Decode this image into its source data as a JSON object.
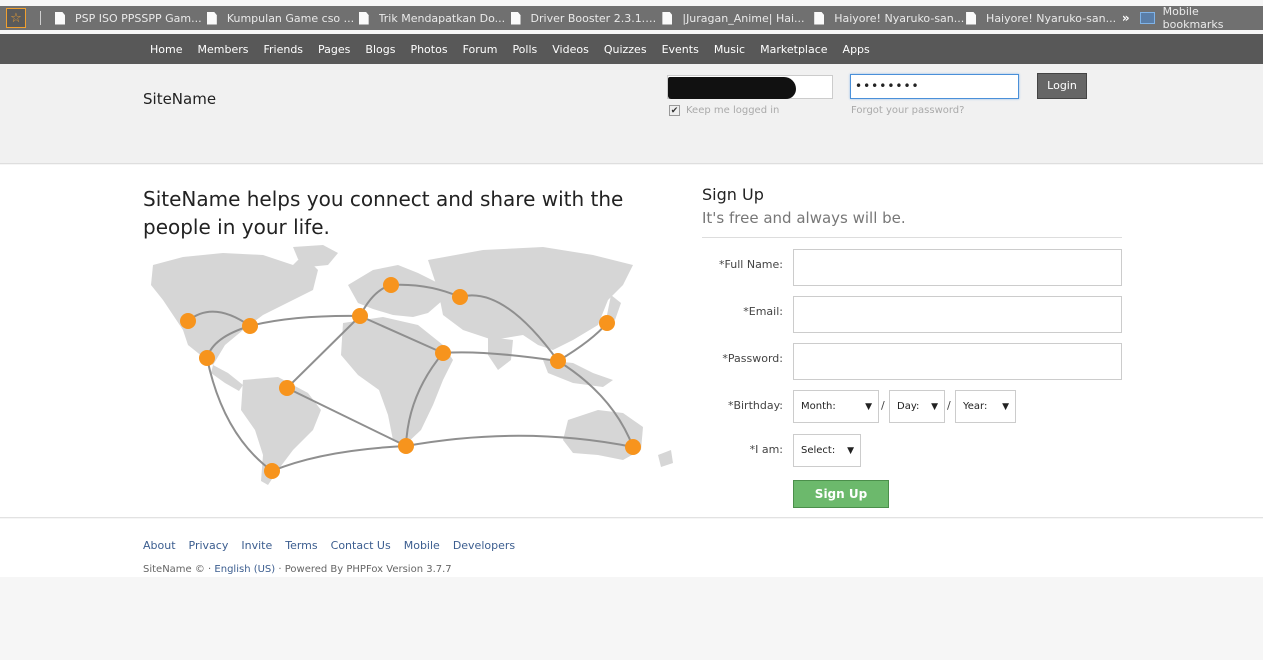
{
  "bookmarks": {
    "items": [
      "PSP ISO PPSSPP Gam...",
      "Kumpulan Game cso ...",
      "Trik Mendapatkan Do...",
      "Driver Booster 2.3.1.0...",
      "|Juragan_Anime| Hai...",
      "Haiyore! Nyaruko-san...",
      "Haiyore! Nyaruko-san..."
    ],
    "more": "»",
    "mobile": "Mobile bookmarks"
  },
  "nav": {
    "items": [
      "Home",
      "Members",
      "Friends",
      "Pages",
      "Blogs",
      "Photos",
      "Forum",
      "Polls",
      "Videos",
      "Quizzes",
      "Events",
      "Music",
      "Marketplace",
      "Apps"
    ]
  },
  "header": {
    "site_name": "SiteName",
    "password_value": "••••••••",
    "keep_logged": "Keep me logged in",
    "forgot": "Forgot your password?",
    "login_label": "Login"
  },
  "main": {
    "tagline": "SiteName helps you connect and share with the people in your life."
  },
  "signup": {
    "title": "Sign Up",
    "subtitle": "It's free and always will be.",
    "full_name_label": "*Full Name:",
    "email_label": "*Email:",
    "password_label": "*Password:",
    "birthday_label": "*Birthday:",
    "month": "Month:",
    "day": "Day:",
    "year": "Year:",
    "slash": "/",
    "gender_label": "*I am:",
    "gender": "Select:",
    "button": "Sign Up"
  },
  "footer": {
    "links": [
      "About",
      "Privacy",
      "Invite",
      "Terms",
      "Contact Us",
      "Mobile",
      "Developers"
    ],
    "copy_site": "SiteName © · ",
    "language": "English (US)",
    "powered": " · Powered By PHPFox Version 3.7.7"
  },
  "colors": {
    "nav_bg": "#585858",
    "pin": "#f7941d",
    "signup_button": "#6cb96c",
    "link": "#3b5d8f"
  }
}
